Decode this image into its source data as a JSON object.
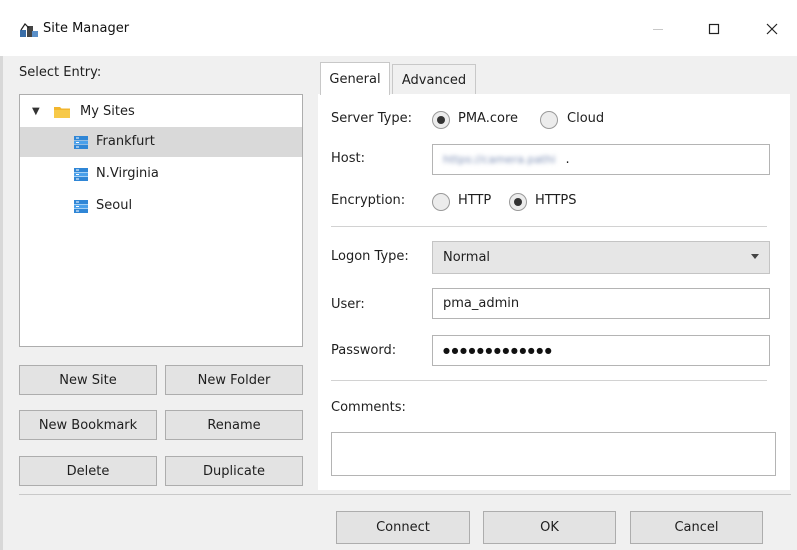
{
  "window": {
    "title": "Site Manager"
  },
  "left": {
    "select_entry_label": "Select Entry:",
    "tree": {
      "folder": "My Sites",
      "sites": [
        "Frankfurt",
        "N.Virginia",
        "Seoul"
      ],
      "selected_site": "Frankfurt"
    },
    "buttons": {
      "new_site": "New Site",
      "new_folder": "New Folder",
      "new_bookmark": "New Bookmark",
      "rename": "Rename",
      "delete": "Delete",
      "duplicate": "Duplicate"
    }
  },
  "tabs": {
    "general": "General",
    "advanced": "Advanced",
    "active": "General"
  },
  "general": {
    "server_type_label": "Server Type:",
    "server_type_options": [
      "PMA.core",
      "Cloud"
    ],
    "server_type_selected": "PMA.core",
    "host_label": "Host:",
    "host_value": "https://camera.pathi",
    "host_trailing": ".",
    "encryption_label": "Encryption:",
    "encryption_options": [
      "HTTP",
      "HTTPS"
    ],
    "encryption_selected": "HTTPS",
    "logon_type_label": "Logon Type:",
    "logon_type_value": "Normal",
    "user_label": "User:",
    "user_value": "pma_admin",
    "password_label": "Password:",
    "password_mask": "●●●●●●●●●●●●●",
    "comments_label": "Comments:",
    "comments_value": ""
  },
  "footer": {
    "connect": "Connect",
    "ok": "OK",
    "cancel": "Cancel"
  }
}
